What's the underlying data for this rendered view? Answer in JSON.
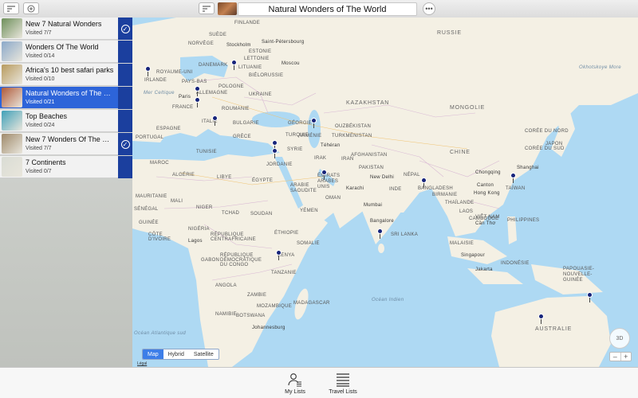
{
  "window": {
    "title": "Natural Wonders of The World"
  },
  "lists": [
    {
      "title": "New 7 Natural Wonders",
      "visited": "Visited 7/7",
      "selected": false,
      "complete": true,
      "thumb": "#6d8f5a"
    },
    {
      "title": "Wonders Of The World",
      "visited": "Visited 0/14",
      "selected": false,
      "complete": false,
      "thumb": "#8aa8c9"
    },
    {
      "title": "Africa's 10 best safari parks",
      "visited": "Visited 0/10",
      "selected": false,
      "complete": false,
      "thumb": "#b79a5d"
    },
    {
      "title": "Natural Wonders of The W...",
      "visited": "Visited 0/21",
      "selected": true,
      "complete": false,
      "thumb": "#b05a3a"
    },
    {
      "title": "Top Beaches",
      "visited": "Visited 0/24",
      "selected": false,
      "complete": false,
      "thumb": "#3fa0b8"
    },
    {
      "title": "New 7 Wonders Of The Wo...",
      "visited": "Visited 7/7",
      "selected": false,
      "complete": true,
      "thumb": "#9f8a6b"
    },
    {
      "title": "7 Continents",
      "visited": "Visited 0/7",
      "selected": false,
      "complete": false,
      "thumb": "#d9dcd4"
    }
  ],
  "map": {
    "labels": {
      "russie": "RUSSIE",
      "finlande": "FINLANDE",
      "suede": "SUÈDE",
      "norvege": "NORVÈGE",
      "stockholm": "Stockholm",
      "st_petersbourg": "Saint-Pétersbourg",
      "estonie": "ESTONIE",
      "lettonie": "LETTONIE",
      "danemark": "DANEMARK",
      "lituanie": "LITUANIE",
      "moscou": "Moscou",
      "royaume_uni": "ROYAUME-UNI",
      "irlande": "IRLANDE",
      "pays_bas": "PAYS-BAS",
      "belarus": "BIÉLORUSSIE",
      "pologne": "POLOGNE",
      "allemagne": "ALLEMAGNE",
      "mer_celtique": "Mer Celtique",
      "paris": "Paris",
      "ukraine": "UKRAINE",
      "france": "FRANCE",
      "roumanie": "ROUMANIE",
      "italie": "ITALIE",
      "bulgarie": "BULGARIE",
      "espagne": "ESPAGNE",
      "portugal": "PORTUGAL",
      "grece": "GRÈCE",
      "tunisie": "TUNISIE",
      "maroc": "MAROC",
      "algerie": "ALGÉRIE",
      "libye": "LIBYE",
      "egypte": "ÉGYPTE",
      "turquie": "TURQUIE",
      "syrie": "SYRIE",
      "irak": "IRAK",
      "iran": "IRAN",
      "jordanie": "JORDANIE",
      "georgie": "GÉORGIE",
      "armenie": "ARMÉNIE",
      "teheran": "Téhéran",
      "kazakhstan": "KAZAKHSTAN",
      "ouzbekistan": "OUZBÉKISTAN",
      "turkmenistan": "TURKMÉNISTAN",
      "afghanistan": "AFGHANISTAN",
      "pakistan": "PAKISTAN",
      "mongolie": "MONGOLIE",
      "chine": "CHINE",
      "coree_nord": "CORÉE DU NORD",
      "coree_sud": "CORÉE DU SUD",
      "japon": "JAPON",
      "okhotsk": "Okhotskoye More",
      "shanghai": "Shanghai",
      "chongqing": "Chongqing",
      "nepal": "NÉPAL",
      "inde": "INDE",
      "new_delhi": "New Delhi",
      "karachi": "Karachi",
      "bangladesh": "BANGLADESH",
      "birmanie": "BIRMANIE",
      "taiwan": "TAÏWAN",
      "canton": "Canton",
      "hong_kong": "Hong Kong",
      "laos": "LAOS",
      "thailande": "THAÏLANDE",
      "viet_nam": "VIÊT NAM",
      "cambodge": "CAMBODGE",
      "can_tho": "Cần Thơ",
      "philippines": "PHILIPPINES",
      "mumbai": "Mumbai",
      "bangalore": "Bangalore",
      "sri_lanka": "SRI LANKA",
      "malaisie": "MALAISIE",
      "singapour": "Singapour",
      "indonesie": "INDONÉSIE",
      "jakarta": "Jakarta",
      "papouasie": "PAPOUASIE-NOUVELLE-GUINÉE",
      "australie": "AUSTRALIE",
      "ocean_indien": "Océan Indien",
      "mauritanie": "MAURITANIE",
      "mali": "MALI",
      "niger": "NIGER",
      "tchad": "TCHAD",
      "soudan": "SOUDAN",
      "senegal": "SÉNÉGAL",
      "guinee": "GUINÉE",
      "cote_divoire": "CÔTE D'IVOIRE",
      "nigeria": "NIGÉRIA",
      "lagos": "Lagos",
      "rca": "RÉPUBLIQUE CENTRAFRICAINE",
      "ethiopie": "ÉTHIOPIE",
      "somalie": "SOMALIE",
      "gabon": "GABON",
      "rdc": "RÉPUBLIQUE DÉMOCRATIQUE DU CONGO",
      "kenya": "KENYA",
      "tanzanie": "TANZANIE",
      "angola": "ANGOLA",
      "zambie": "ZAMBIE",
      "namibie": "NAMIBIE",
      "botswana": "BOTSWANA",
      "mozambique": "MOZAMBIQUE",
      "madagascar": "MADAGASCAR",
      "johannesburg": "Johannesburg",
      "arabie": "ARABIE SAOUDITE",
      "emirats": "ÉMIRATS ARABES UNIS",
      "oman": "OMAN",
      "yemen": "YÉMEN",
      "atl_sud": "Océan Atlantique sud",
      "legal": "Légal"
    },
    "modes": [
      "Map",
      "Hybrid",
      "Satellite"
    ],
    "active_mode": "Map",
    "compass": "3D",
    "zoom_out": "–",
    "zoom_in": "+"
  },
  "tabs": [
    {
      "label": "My Lists",
      "icon": "person-list-icon"
    },
    {
      "label": "Travel Lists",
      "icon": "list-lines-icon"
    }
  ],
  "colors": {
    "accent": "#2d64d9",
    "pin": "#17247a",
    "water": "#aed9f3",
    "land": "#f4f0e4"
  }
}
